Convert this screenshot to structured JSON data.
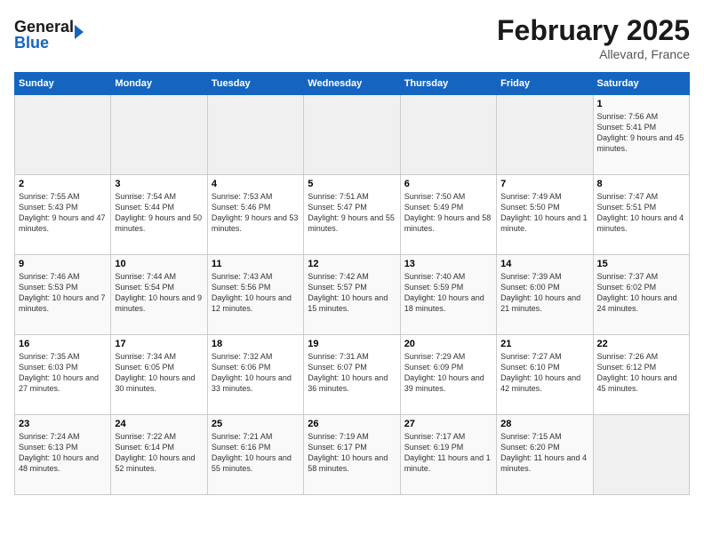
{
  "header": {
    "logo_line1": "General",
    "logo_line2": "Blue",
    "month": "February 2025",
    "location": "Allevard, France"
  },
  "weekdays": [
    "Sunday",
    "Monday",
    "Tuesday",
    "Wednesday",
    "Thursday",
    "Friday",
    "Saturday"
  ],
  "weeks": [
    [
      {
        "day": "",
        "info": ""
      },
      {
        "day": "",
        "info": ""
      },
      {
        "day": "",
        "info": ""
      },
      {
        "day": "",
        "info": ""
      },
      {
        "day": "",
        "info": ""
      },
      {
        "day": "",
        "info": ""
      },
      {
        "day": "1",
        "info": "Sunrise: 7:56 AM\nSunset: 5:41 PM\nDaylight: 9 hours and 45 minutes."
      }
    ],
    [
      {
        "day": "2",
        "info": "Sunrise: 7:55 AM\nSunset: 5:43 PM\nDaylight: 9 hours and 47 minutes."
      },
      {
        "day": "3",
        "info": "Sunrise: 7:54 AM\nSunset: 5:44 PM\nDaylight: 9 hours and 50 minutes."
      },
      {
        "day": "4",
        "info": "Sunrise: 7:53 AM\nSunset: 5:46 PM\nDaylight: 9 hours and 53 minutes."
      },
      {
        "day": "5",
        "info": "Sunrise: 7:51 AM\nSunset: 5:47 PM\nDaylight: 9 hours and 55 minutes."
      },
      {
        "day": "6",
        "info": "Sunrise: 7:50 AM\nSunset: 5:49 PM\nDaylight: 9 hours and 58 minutes."
      },
      {
        "day": "7",
        "info": "Sunrise: 7:49 AM\nSunset: 5:50 PM\nDaylight: 10 hours and 1 minute."
      },
      {
        "day": "8",
        "info": "Sunrise: 7:47 AM\nSunset: 5:51 PM\nDaylight: 10 hours and 4 minutes."
      }
    ],
    [
      {
        "day": "9",
        "info": "Sunrise: 7:46 AM\nSunset: 5:53 PM\nDaylight: 10 hours and 7 minutes."
      },
      {
        "day": "10",
        "info": "Sunrise: 7:44 AM\nSunset: 5:54 PM\nDaylight: 10 hours and 9 minutes."
      },
      {
        "day": "11",
        "info": "Sunrise: 7:43 AM\nSunset: 5:56 PM\nDaylight: 10 hours and 12 minutes."
      },
      {
        "day": "12",
        "info": "Sunrise: 7:42 AM\nSunset: 5:57 PM\nDaylight: 10 hours and 15 minutes."
      },
      {
        "day": "13",
        "info": "Sunrise: 7:40 AM\nSunset: 5:59 PM\nDaylight: 10 hours and 18 minutes."
      },
      {
        "day": "14",
        "info": "Sunrise: 7:39 AM\nSunset: 6:00 PM\nDaylight: 10 hours and 21 minutes."
      },
      {
        "day": "15",
        "info": "Sunrise: 7:37 AM\nSunset: 6:02 PM\nDaylight: 10 hours and 24 minutes."
      }
    ],
    [
      {
        "day": "16",
        "info": "Sunrise: 7:35 AM\nSunset: 6:03 PM\nDaylight: 10 hours and 27 minutes."
      },
      {
        "day": "17",
        "info": "Sunrise: 7:34 AM\nSunset: 6:05 PM\nDaylight: 10 hours and 30 minutes."
      },
      {
        "day": "18",
        "info": "Sunrise: 7:32 AM\nSunset: 6:06 PM\nDaylight: 10 hours and 33 minutes."
      },
      {
        "day": "19",
        "info": "Sunrise: 7:31 AM\nSunset: 6:07 PM\nDaylight: 10 hours and 36 minutes."
      },
      {
        "day": "20",
        "info": "Sunrise: 7:29 AM\nSunset: 6:09 PM\nDaylight: 10 hours and 39 minutes."
      },
      {
        "day": "21",
        "info": "Sunrise: 7:27 AM\nSunset: 6:10 PM\nDaylight: 10 hours and 42 minutes."
      },
      {
        "day": "22",
        "info": "Sunrise: 7:26 AM\nSunset: 6:12 PM\nDaylight: 10 hours and 45 minutes."
      }
    ],
    [
      {
        "day": "23",
        "info": "Sunrise: 7:24 AM\nSunset: 6:13 PM\nDaylight: 10 hours and 48 minutes."
      },
      {
        "day": "24",
        "info": "Sunrise: 7:22 AM\nSunset: 6:14 PM\nDaylight: 10 hours and 52 minutes."
      },
      {
        "day": "25",
        "info": "Sunrise: 7:21 AM\nSunset: 6:16 PM\nDaylight: 10 hours and 55 minutes."
      },
      {
        "day": "26",
        "info": "Sunrise: 7:19 AM\nSunset: 6:17 PM\nDaylight: 10 hours and 58 minutes."
      },
      {
        "day": "27",
        "info": "Sunrise: 7:17 AM\nSunset: 6:19 PM\nDaylight: 11 hours and 1 minute."
      },
      {
        "day": "28",
        "info": "Sunrise: 7:15 AM\nSunset: 6:20 PM\nDaylight: 11 hours and 4 minutes."
      },
      {
        "day": "",
        "info": ""
      }
    ]
  ]
}
